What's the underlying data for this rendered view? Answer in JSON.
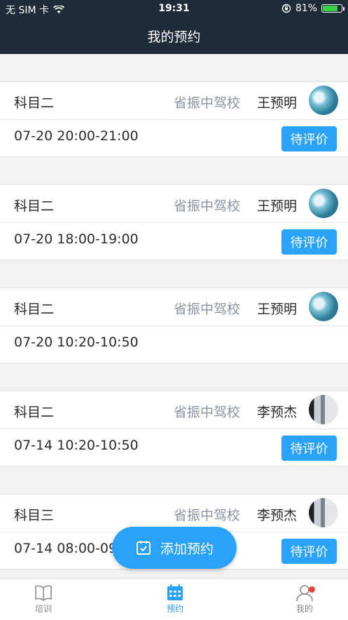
{
  "status_bar": {
    "carrier": "无 SIM 卡",
    "time": "19:31",
    "battery_percent_text": "81%",
    "battery_level": 0.81
  },
  "header": {
    "title": "我的预约"
  },
  "appointments": [
    {
      "subject": "科目二",
      "school": "省振中驾校",
      "coach": "王预明",
      "time": "07-20 20:00-21:00",
      "action": "待评价",
      "avatar": "sea"
    },
    {
      "subject": "科目二",
      "school": "省振中驾校",
      "coach": "王预明",
      "time": "07-20 18:00-19:00",
      "action": "待评价",
      "avatar": "sea"
    },
    {
      "subject": "科目二",
      "school": "省振中驾校",
      "coach": "王预明",
      "time": "07-20 10:20-10:50",
      "action": "",
      "avatar": "sea"
    },
    {
      "subject": "科目二",
      "school": "省振中驾校",
      "coach": "李预杰",
      "time": "07-14 10:20-10:50",
      "action": "待评价",
      "avatar": "building"
    },
    {
      "subject": "科目三",
      "school": "省振中驾校",
      "coach": "李预杰",
      "time": "07-14 08:00-09:00",
      "action": "待评价",
      "avatar": "building"
    }
  ],
  "fab": {
    "label": "添加预约",
    "icon": "calendar-check-icon"
  },
  "tab_bar": {
    "items": [
      {
        "label": "培训",
        "icon": "book-icon"
      },
      {
        "label": "预约",
        "icon": "calendar-icon",
        "active": true
      },
      {
        "label": "我的",
        "icon": "user-icon",
        "badge": true
      }
    ]
  },
  "colors": {
    "accent": "#2aa2f7",
    "header_bg": "#1f2b38",
    "badge": "#e8403a"
  }
}
